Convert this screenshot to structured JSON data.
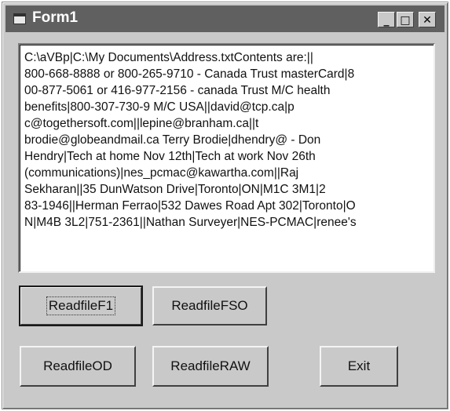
{
  "window": {
    "title": "Form1"
  },
  "titlebar_buttons": {
    "minimize": "_",
    "maximize": "□",
    "close": "✕"
  },
  "textbox": {
    "lines": [
      "C:\\aVBp|C:\\My Documents\\Address.txtContents are:||",
      "800-668-8888 or 800-265-9710 - Canada Trust masterCard|8",
      "00-877-5061 or 416-977-2156 - canada Trust M/C health",
      "benefits|800-307-730-9 M/C USA||david@tcp.ca|p",
      "c@togethersoft.com||lepine@branham.ca||t",
      "brodie@globeandmail.ca Terry Brodie|dhendry@ - Don",
      "Hendry|Tech at home Nov 12th|Tech at work Nov  26th",
      "(communications)|nes_pcmac@kawartha.com||Raj",
      "Sekharan||35 DunWatson Drive|Toronto|ON|M1C 3M1|2",
      "83-1946||Herman Ferrao|532 Dawes Road Apt 302|Toronto|O",
      "N|M4B 3L2|751-2361||Nathan Surveyer|NES-PCMAC|renee's"
    ]
  },
  "buttons": {
    "readfile_f1": "ReadfileF1",
    "readfile_fso": "ReadfileFSO",
    "readfile_od": "ReadfileOD",
    "readfile_raw": "ReadfileRAW",
    "exit": "Exit"
  }
}
